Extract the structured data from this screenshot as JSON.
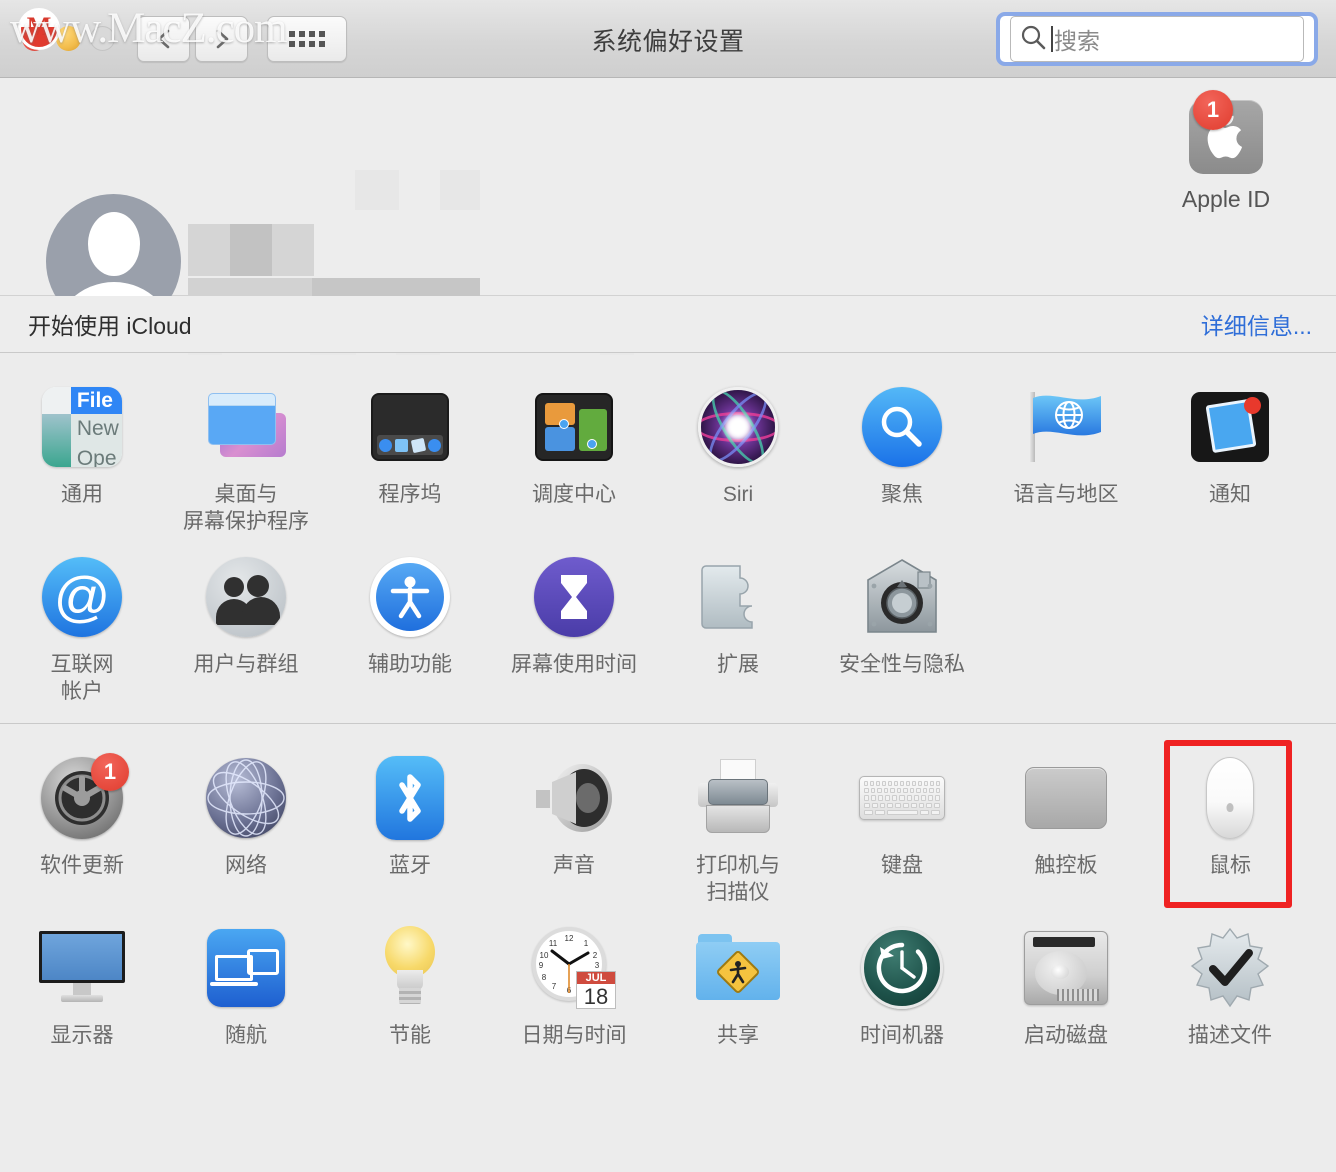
{
  "window": {
    "title": "系统偏好设置",
    "watermark": "www.MacZ.com",
    "watermark_logo": "M"
  },
  "toolbar": {
    "back_icon": "back-arrow-icon",
    "forward_icon": "forward-arrow-icon",
    "show_all_icon": "grid-icon"
  },
  "search": {
    "placeholder": "搜索",
    "value": "",
    "icon": "search-icon",
    "focused": true
  },
  "account": {
    "avatar_icon": "user-avatar-icon",
    "name_redacted": true,
    "apple_id": {
      "label": "Apple ID",
      "icon": "apple-logo-icon",
      "badge": "1",
      "badge_color": "#e03c2e"
    }
  },
  "icloud": {
    "label": "开始使用 iCloud",
    "link": "详细信息...",
    "link_color": "#2f6ed8"
  },
  "sections": [
    {
      "name": "personal",
      "rows": [
        [
          {
            "label": "通用",
            "icon": "general-icon"
          },
          {
            "label": "桌面与\n屏幕保护程序",
            "icon": "desktop-screensaver-icon"
          },
          {
            "label": "程序坞",
            "icon": "dock-icon"
          },
          {
            "label": "调度中心",
            "icon": "mission-control-icon"
          },
          {
            "label": "Siri",
            "icon": "siri-icon"
          },
          {
            "label": "聚焦",
            "icon": "spotlight-icon"
          },
          {
            "label": "语言与地区",
            "icon": "language-region-icon"
          },
          {
            "label": "通知",
            "icon": "notifications-icon"
          }
        ],
        [
          {
            "label": "互联网\n帐户",
            "icon": "internet-accounts-icon"
          },
          {
            "label": "用户与群组",
            "icon": "users-groups-icon"
          },
          {
            "label": "辅助功能",
            "icon": "accessibility-icon"
          },
          {
            "label": "屏幕使用时间",
            "icon": "screen-time-icon"
          },
          {
            "label": "扩展",
            "icon": "extensions-icon"
          },
          {
            "label": "安全性与隐私",
            "icon": "security-privacy-icon"
          }
        ]
      ]
    },
    {
      "name": "hardware",
      "rows": [
        [
          {
            "label": "软件更新",
            "icon": "software-update-icon",
            "badge": "1"
          },
          {
            "label": "网络",
            "icon": "network-icon"
          },
          {
            "label": "蓝牙",
            "icon": "bluetooth-icon"
          },
          {
            "label": "声音",
            "icon": "sound-icon"
          },
          {
            "label": "打印机与\n扫描仪",
            "icon": "printers-scanners-icon"
          },
          {
            "label": "键盘",
            "icon": "keyboard-icon"
          },
          {
            "label": "触控板",
            "icon": "trackpad-icon"
          },
          {
            "label": "鼠标",
            "icon": "mouse-icon",
            "highlighted": true
          }
        ],
        [
          {
            "label": "显示器",
            "icon": "displays-icon"
          },
          {
            "label": "随航",
            "icon": "sidecar-icon"
          },
          {
            "label": "节能",
            "icon": "energy-saver-icon"
          },
          {
            "label": "日期与时间",
            "icon": "date-time-icon",
            "month": "JUL",
            "day": "18"
          },
          {
            "label": "共享",
            "icon": "sharing-icon"
          },
          {
            "label": "时间机器",
            "icon": "time-machine-icon"
          },
          {
            "label": "启动磁盘",
            "icon": "startup-disk-icon"
          },
          {
            "label": "描述文件",
            "icon": "profiles-icon"
          }
        ]
      ]
    }
  ],
  "highlight_color": "#ef2222"
}
